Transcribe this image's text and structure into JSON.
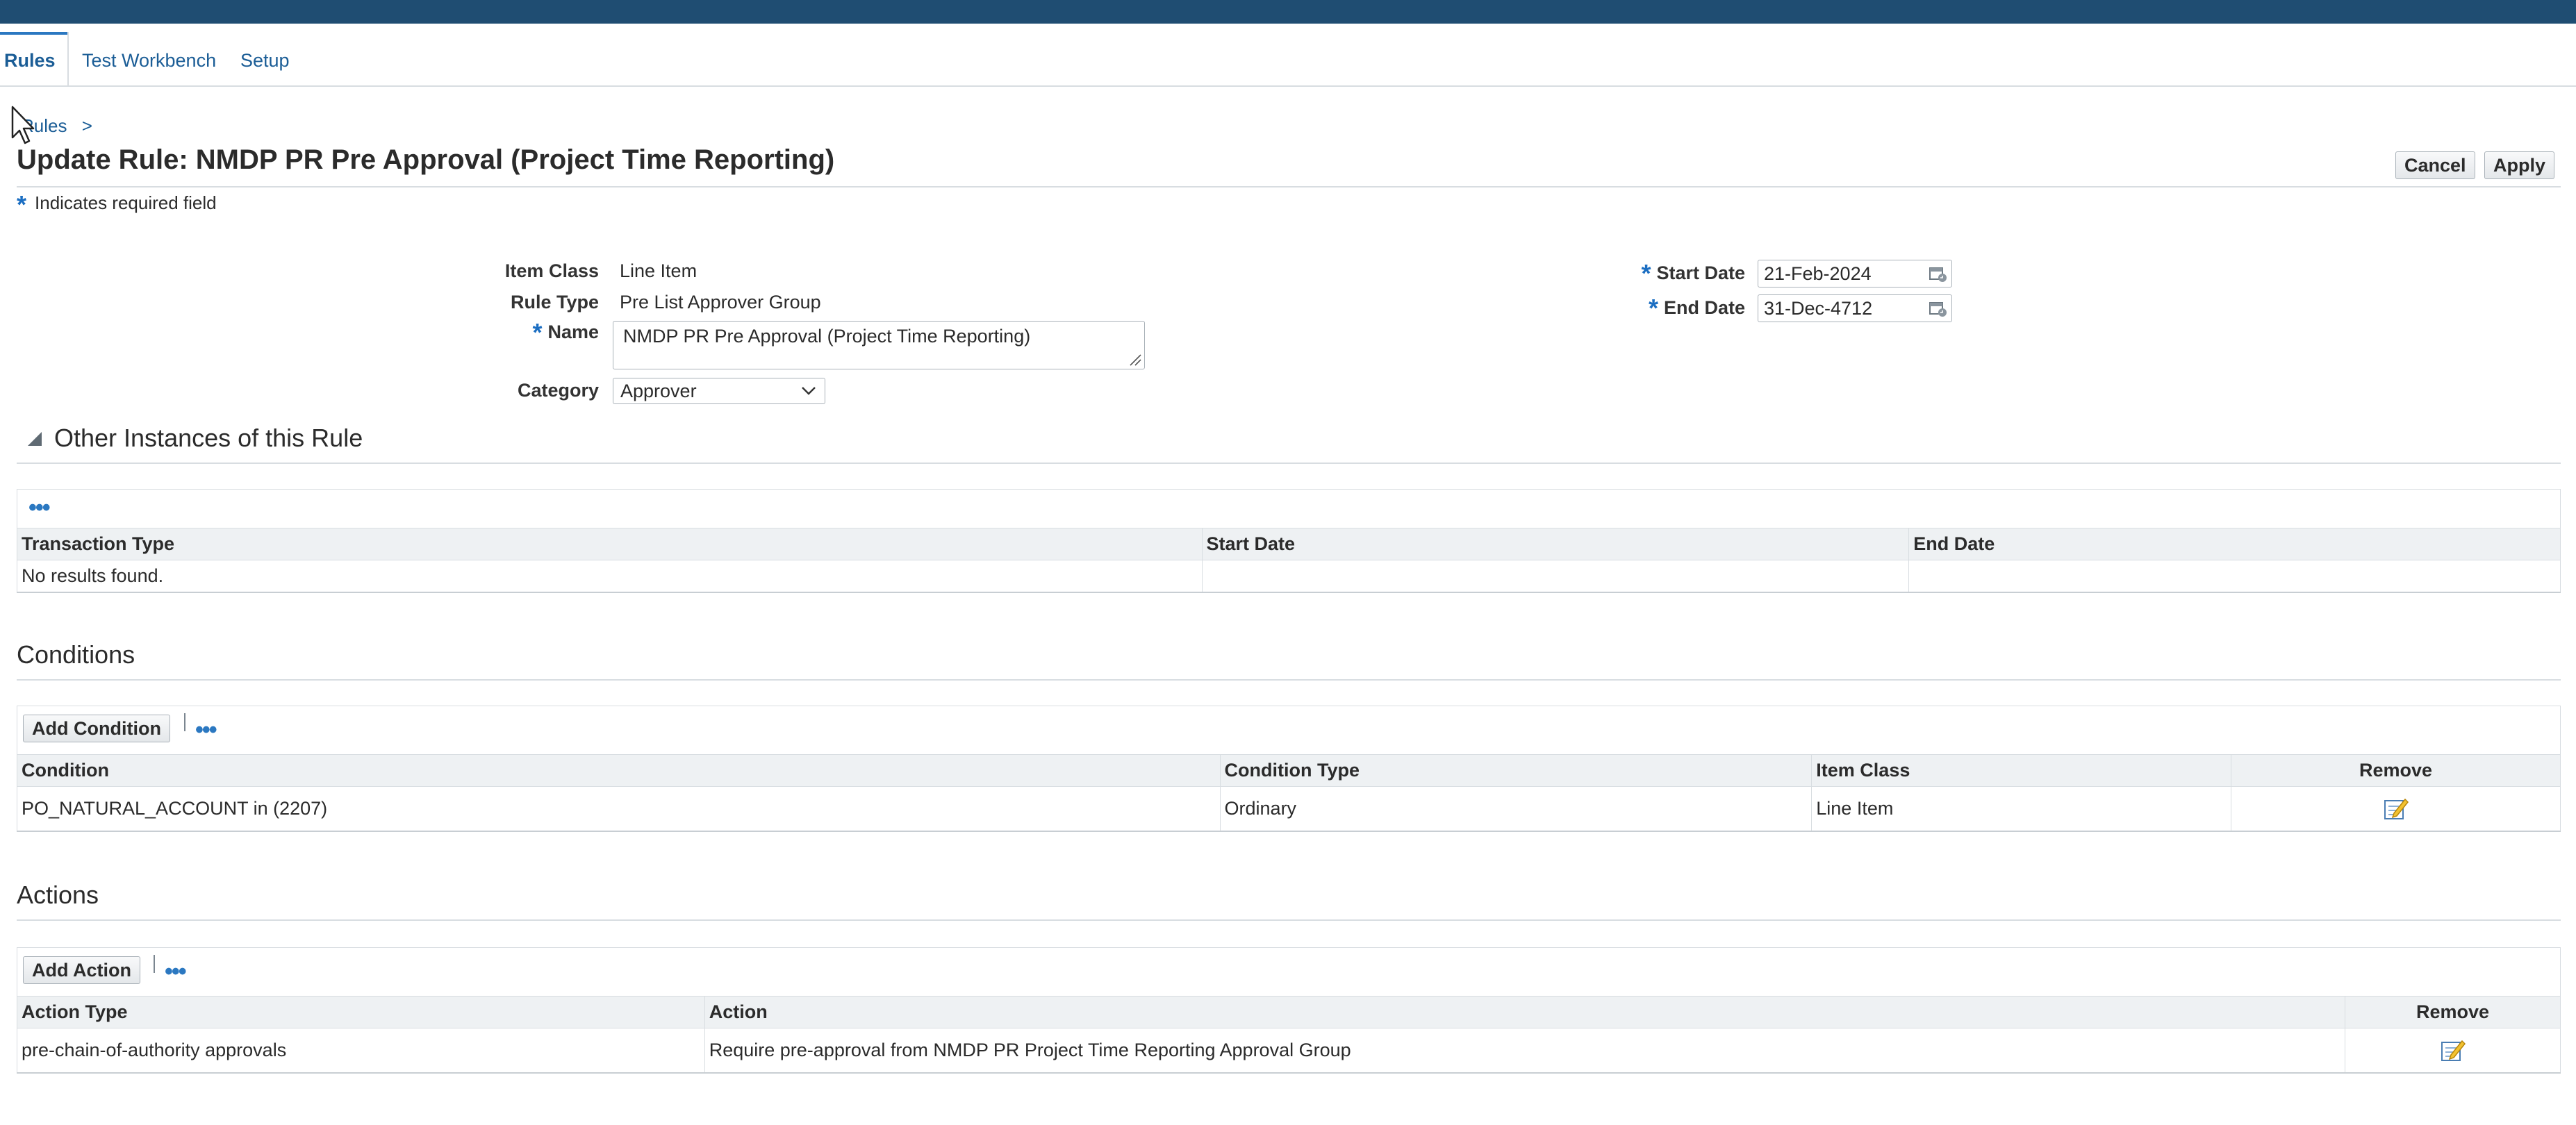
{
  "tabs": [
    {
      "label": "Rules",
      "active": true
    },
    {
      "label": "Test Workbench"
    },
    {
      "label": "Setup"
    }
  ],
  "breadcrumb": {
    "link": "Rules",
    "separator": ">"
  },
  "page": {
    "title": "Update Rule: NMDP PR Pre Approval (Project Time Reporting)"
  },
  "buttons": {
    "cancel": "Cancel",
    "apply": "Apply"
  },
  "required_note": "Indicates required field",
  "form": {
    "item_class_label": "Item Class",
    "item_class_value": "Line Item",
    "rule_type_label": "Rule Type",
    "rule_type_value": "Pre List Approver Group",
    "name_label": "Name",
    "name_value": "NMDP PR Pre Approval (Project Time Reporting)",
    "category_label": "Category",
    "category_value": "Approver",
    "start_date_label": "Start Date",
    "start_date_value": "21-Feb-2024",
    "end_date_label": "End Date",
    "end_date_value": "31-Dec-4712"
  },
  "other_instances": {
    "title": "Other Instances of this Rule",
    "columns": [
      "Transaction Type",
      "Start Date",
      "End Date"
    ],
    "empty_text": "No results found."
  },
  "conditions": {
    "title": "Conditions",
    "add_button": "Add Condition",
    "columns": [
      "Condition",
      "Condition Type",
      "Item Class",
      "Remove"
    ],
    "rows": [
      {
        "condition": "PO_NATURAL_ACCOUNT in (2207)",
        "type": "Ordinary",
        "item_class": "Line Item"
      }
    ]
  },
  "actions": {
    "title": "Actions",
    "add_button": "Add Action",
    "columns": [
      "Action Type",
      "Action",
      "Remove"
    ],
    "rows": [
      {
        "action_type": "pre-chain-of-authority approvals",
        "action": "Require pre-approval from NMDP PR Project Time Reporting Approval Group"
      }
    ]
  },
  "colors": {
    "header_bar": "#1f4d72",
    "link": "#1b5d96",
    "accent": "#2b78c1",
    "required": "#1b6ec2"
  },
  "icons": [
    "mouse-cursor-icon",
    "calendar-icon",
    "chevron-down-icon",
    "disclosure-triangle-icon",
    "more-actions-icon",
    "update-icon",
    "resize-grip-icon"
  ]
}
